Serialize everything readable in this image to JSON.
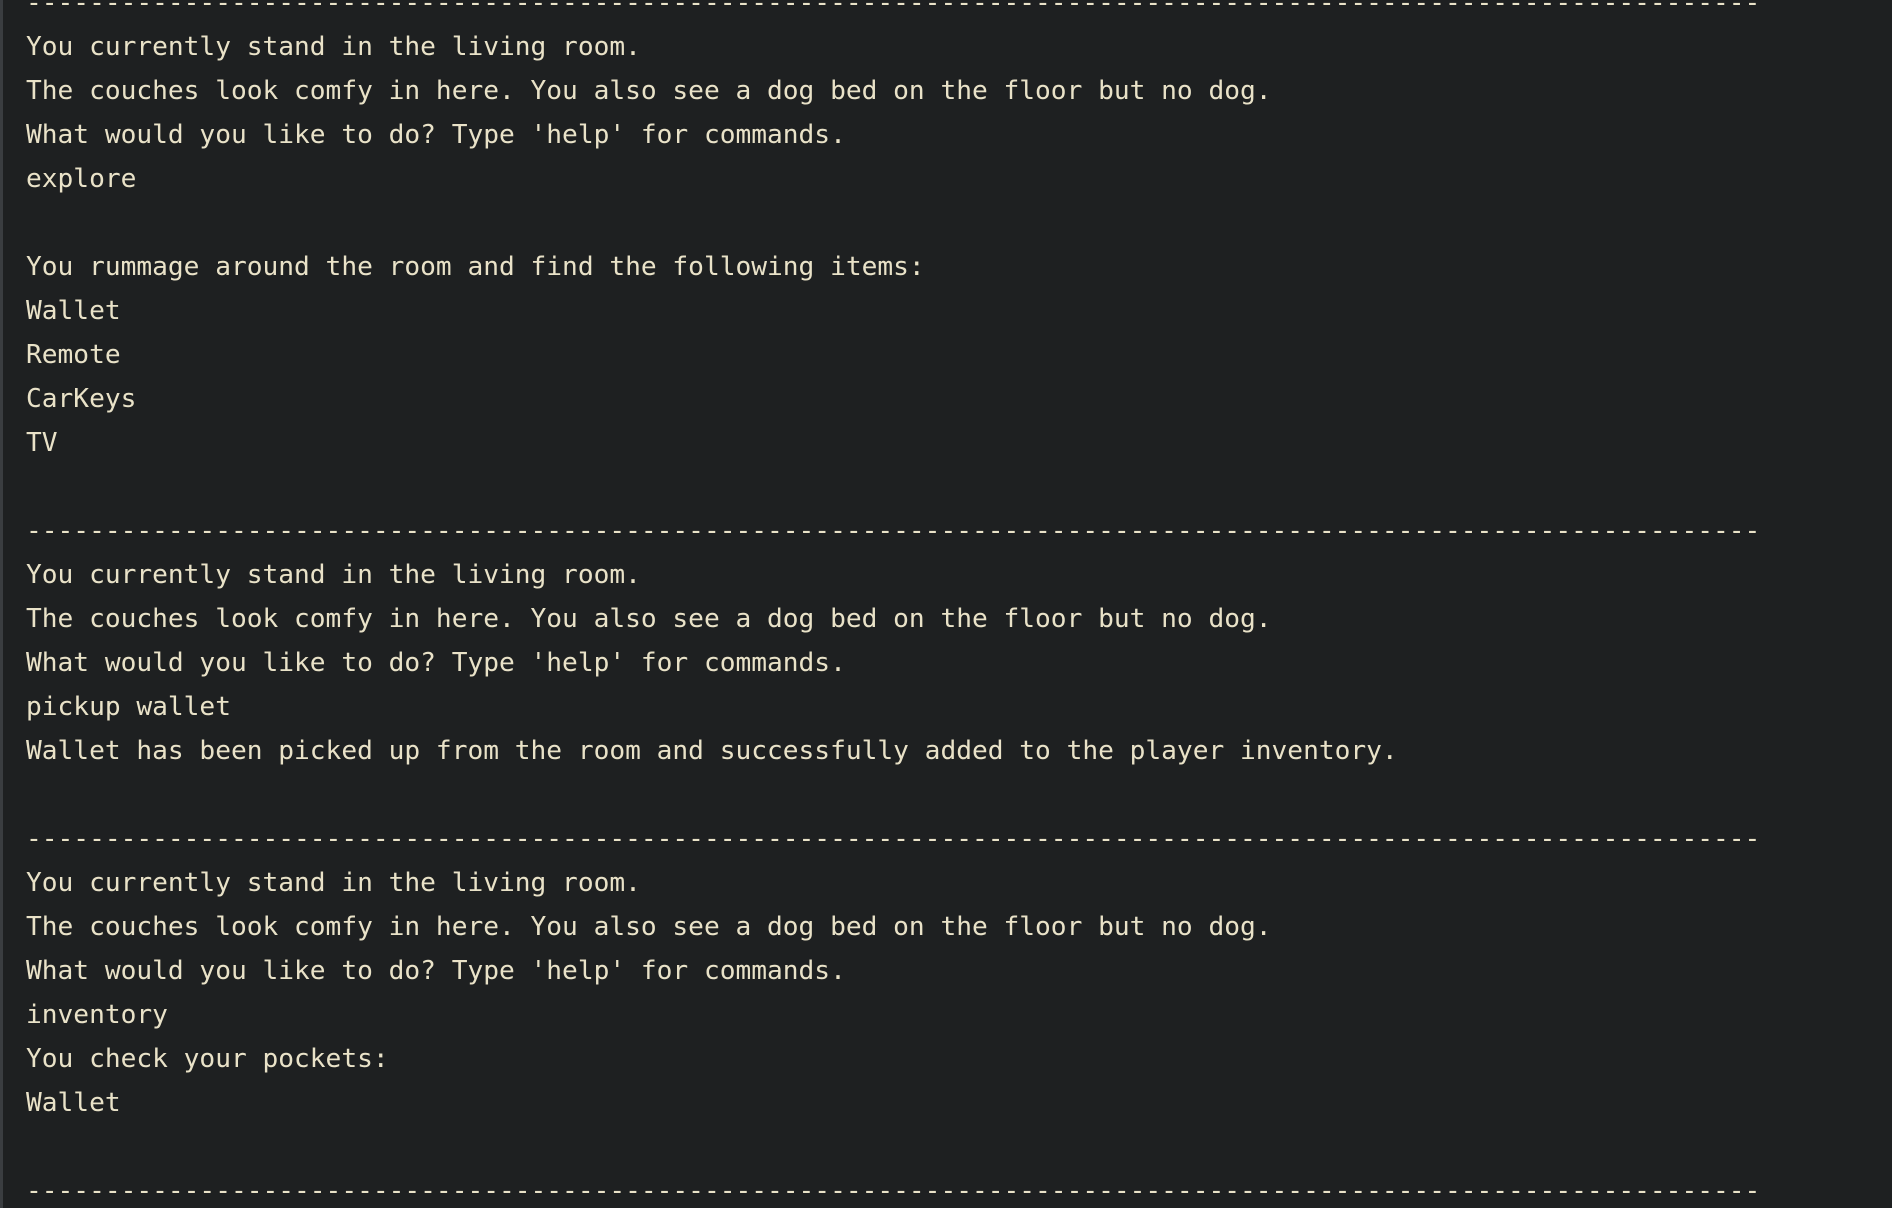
{
  "console": {
    "lines": [
      {
        "type": "divider",
        "text": "--------------------------------------------------------------------------------------------------------------"
      },
      {
        "type": "output",
        "text": "You currently stand in the living room."
      },
      {
        "type": "output",
        "text": "The couches look comfy in here. You also see a dog bed on the floor but no dog."
      },
      {
        "type": "output",
        "text": "What would you like to do? Type 'help' for commands."
      },
      {
        "type": "input",
        "text": "explore"
      },
      {
        "type": "blank",
        "text": ""
      },
      {
        "type": "output",
        "text": "You rummage around the room and find the following items:"
      },
      {
        "type": "output",
        "text": "Wallet"
      },
      {
        "type": "output",
        "text": "Remote"
      },
      {
        "type": "output",
        "text": "CarKeys"
      },
      {
        "type": "output",
        "text": "TV"
      },
      {
        "type": "blank",
        "text": ""
      },
      {
        "type": "divider",
        "text": "--------------------------------------------------------------------------------------------------------------"
      },
      {
        "type": "output",
        "text": "You currently stand in the living room."
      },
      {
        "type": "output",
        "text": "The couches look comfy in here. You also see a dog bed on the floor but no dog."
      },
      {
        "type": "output",
        "text": "What would you like to do? Type 'help' for commands."
      },
      {
        "type": "input",
        "text": "pickup wallet"
      },
      {
        "type": "output",
        "text": "Wallet has been picked up from the room and successfully added to the player inventory."
      },
      {
        "type": "blank",
        "text": ""
      },
      {
        "type": "divider",
        "text": "--------------------------------------------------------------------------------------------------------------"
      },
      {
        "type": "output",
        "text": "You currently stand in the living room."
      },
      {
        "type": "output",
        "text": "The couches look comfy in here. You also see a dog bed on the floor but no dog."
      },
      {
        "type": "output",
        "text": "What would you like to do? Type 'help' for commands."
      },
      {
        "type": "input",
        "text": "inventory"
      },
      {
        "type": "output",
        "text": "You check your pockets:"
      },
      {
        "type": "output",
        "text": "Wallet"
      },
      {
        "type": "blank",
        "text": ""
      },
      {
        "type": "divider",
        "text": "--------------------------------------------------------------------------------------------------------------"
      }
    ]
  },
  "colors": {
    "background": "#1e2021",
    "text": "#e9e2c8",
    "gutter": "#3a3d40"
  }
}
